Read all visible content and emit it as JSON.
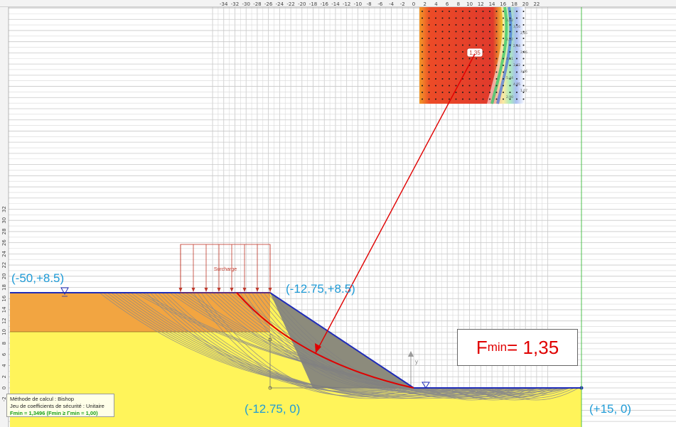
{
  "x_axis_ticks": [
    "-34",
    "-32",
    "-30",
    "-28",
    "-26",
    "-24",
    "-22",
    "-20",
    "-18",
    "-16",
    "-14",
    "-12",
    "-10",
    "-8",
    "-6",
    "-4",
    "-2",
    "0",
    "2",
    "4",
    "6",
    "8",
    "10",
    "12",
    "14",
    "16",
    "18",
    "20",
    "22"
  ],
  "y_axis_ticks": [
    "32",
    "30",
    "28",
    "26",
    "24",
    "22",
    "20",
    "18",
    "16",
    "14",
    "12",
    "10",
    "8",
    "6",
    "4",
    "2",
    "0",
    "-2"
  ],
  "labels": {
    "top_left": "(-50,+8.5)",
    "crest": "(-12.75,+8.5)",
    "toe": "(-12.75, 0)",
    "right": "(+15, 0)",
    "surcharge": "Surcharge",
    "contour_min": "1,35",
    "y_axis_marker": "y",
    "x_axis_marker": "x"
  },
  "fmin": {
    "prefix": "F",
    "sub": "min",
    "value": " = 1,35"
  },
  "info": {
    "line1": "Méthode de calcul : Bishop",
    "line2": "Jeu de coefficients de sécurité : Unitaire",
    "line3": "Fmin = 1,3496 (Fmin ≥ Γmin = 1,00)"
  },
  "contour_values": [
    "3,62",
    "3,16",
    "2,65",
    "2,57",
    "2,34",
    "2,26",
    "4,51",
    "3,82",
    "3,06",
    "5,44",
    "4,85",
    "1,07",
    "2,90"
  ],
  "colors": {
    "orange_layer": "#f2a541",
    "yellow_layer": "#fff45a",
    "slope_cut": "#7f7f7f",
    "surface_line": "#1f2cb8",
    "critical_circle": "#e00000",
    "coord_text": "#1f9bd7",
    "green_boundary": "#4cc24c"
  }
}
